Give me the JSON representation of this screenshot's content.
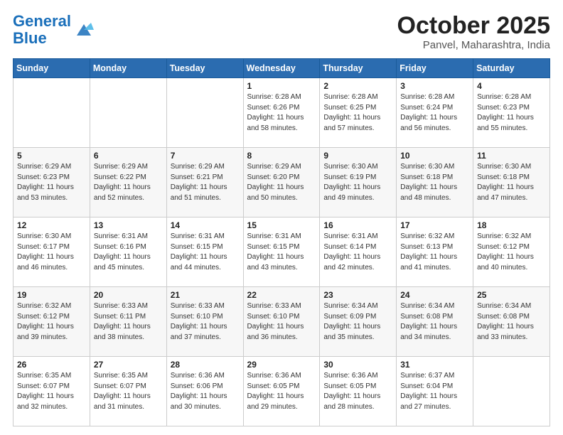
{
  "header": {
    "logo_text_general": "General",
    "logo_text_blue": "Blue",
    "month_title": "October 2025",
    "location": "Panvel, Maharashtra, India"
  },
  "days_of_week": [
    "Sunday",
    "Monday",
    "Tuesday",
    "Wednesday",
    "Thursday",
    "Friday",
    "Saturday"
  ],
  "weeks": [
    [
      {
        "day": "",
        "content": ""
      },
      {
        "day": "",
        "content": ""
      },
      {
        "day": "",
        "content": ""
      },
      {
        "day": "1",
        "content": "Sunrise: 6:28 AM\nSunset: 6:26 PM\nDaylight: 11 hours\nand 58 minutes."
      },
      {
        "day": "2",
        "content": "Sunrise: 6:28 AM\nSunset: 6:25 PM\nDaylight: 11 hours\nand 57 minutes."
      },
      {
        "day": "3",
        "content": "Sunrise: 6:28 AM\nSunset: 6:24 PM\nDaylight: 11 hours\nand 56 minutes."
      },
      {
        "day": "4",
        "content": "Sunrise: 6:28 AM\nSunset: 6:23 PM\nDaylight: 11 hours\nand 55 minutes."
      }
    ],
    [
      {
        "day": "5",
        "content": "Sunrise: 6:29 AM\nSunset: 6:23 PM\nDaylight: 11 hours\nand 53 minutes."
      },
      {
        "day": "6",
        "content": "Sunrise: 6:29 AM\nSunset: 6:22 PM\nDaylight: 11 hours\nand 52 minutes."
      },
      {
        "day": "7",
        "content": "Sunrise: 6:29 AM\nSunset: 6:21 PM\nDaylight: 11 hours\nand 51 minutes."
      },
      {
        "day": "8",
        "content": "Sunrise: 6:29 AM\nSunset: 6:20 PM\nDaylight: 11 hours\nand 50 minutes."
      },
      {
        "day": "9",
        "content": "Sunrise: 6:30 AM\nSunset: 6:19 PM\nDaylight: 11 hours\nand 49 minutes."
      },
      {
        "day": "10",
        "content": "Sunrise: 6:30 AM\nSunset: 6:18 PM\nDaylight: 11 hours\nand 48 minutes."
      },
      {
        "day": "11",
        "content": "Sunrise: 6:30 AM\nSunset: 6:18 PM\nDaylight: 11 hours\nand 47 minutes."
      }
    ],
    [
      {
        "day": "12",
        "content": "Sunrise: 6:30 AM\nSunset: 6:17 PM\nDaylight: 11 hours\nand 46 minutes."
      },
      {
        "day": "13",
        "content": "Sunrise: 6:31 AM\nSunset: 6:16 PM\nDaylight: 11 hours\nand 45 minutes."
      },
      {
        "day": "14",
        "content": "Sunrise: 6:31 AM\nSunset: 6:15 PM\nDaylight: 11 hours\nand 44 minutes."
      },
      {
        "day": "15",
        "content": "Sunrise: 6:31 AM\nSunset: 6:15 PM\nDaylight: 11 hours\nand 43 minutes."
      },
      {
        "day": "16",
        "content": "Sunrise: 6:31 AM\nSunset: 6:14 PM\nDaylight: 11 hours\nand 42 minutes."
      },
      {
        "day": "17",
        "content": "Sunrise: 6:32 AM\nSunset: 6:13 PM\nDaylight: 11 hours\nand 41 minutes."
      },
      {
        "day": "18",
        "content": "Sunrise: 6:32 AM\nSunset: 6:12 PM\nDaylight: 11 hours\nand 40 minutes."
      }
    ],
    [
      {
        "day": "19",
        "content": "Sunrise: 6:32 AM\nSunset: 6:12 PM\nDaylight: 11 hours\nand 39 minutes."
      },
      {
        "day": "20",
        "content": "Sunrise: 6:33 AM\nSunset: 6:11 PM\nDaylight: 11 hours\nand 38 minutes."
      },
      {
        "day": "21",
        "content": "Sunrise: 6:33 AM\nSunset: 6:10 PM\nDaylight: 11 hours\nand 37 minutes."
      },
      {
        "day": "22",
        "content": "Sunrise: 6:33 AM\nSunset: 6:10 PM\nDaylight: 11 hours\nand 36 minutes."
      },
      {
        "day": "23",
        "content": "Sunrise: 6:34 AM\nSunset: 6:09 PM\nDaylight: 11 hours\nand 35 minutes."
      },
      {
        "day": "24",
        "content": "Sunrise: 6:34 AM\nSunset: 6:08 PM\nDaylight: 11 hours\nand 34 minutes."
      },
      {
        "day": "25",
        "content": "Sunrise: 6:34 AM\nSunset: 6:08 PM\nDaylight: 11 hours\nand 33 minutes."
      }
    ],
    [
      {
        "day": "26",
        "content": "Sunrise: 6:35 AM\nSunset: 6:07 PM\nDaylight: 11 hours\nand 32 minutes."
      },
      {
        "day": "27",
        "content": "Sunrise: 6:35 AM\nSunset: 6:07 PM\nDaylight: 11 hours\nand 31 minutes."
      },
      {
        "day": "28",
        "content": "Sunrise: 6:36 AM\nSunset: 6:06 PM\nDaylight: 11 hours\nand 30 minutes."
      },
      {
        "day": "29",
        "content": "Sunrise: 6:36 AM\nSunset: 6:05 PM\nDaylight: 11 hours\nand 29 minutes."
      },
      {
        "day": "30",
        "content": "Sunrise: 6:36 AM\nSunset: 6:05 PM\nDaylight: 11 hours\nand 28 minutes."
      },
      {
        "day": "31",
        "content": "Sunrise: 6:37 AM\nSunset: 6:04 PM\nDaylight: 11 hours\nand 27 minutes."
      },
      {
        "day": "",
        "content": ""
      }
    ]
  ]
}
